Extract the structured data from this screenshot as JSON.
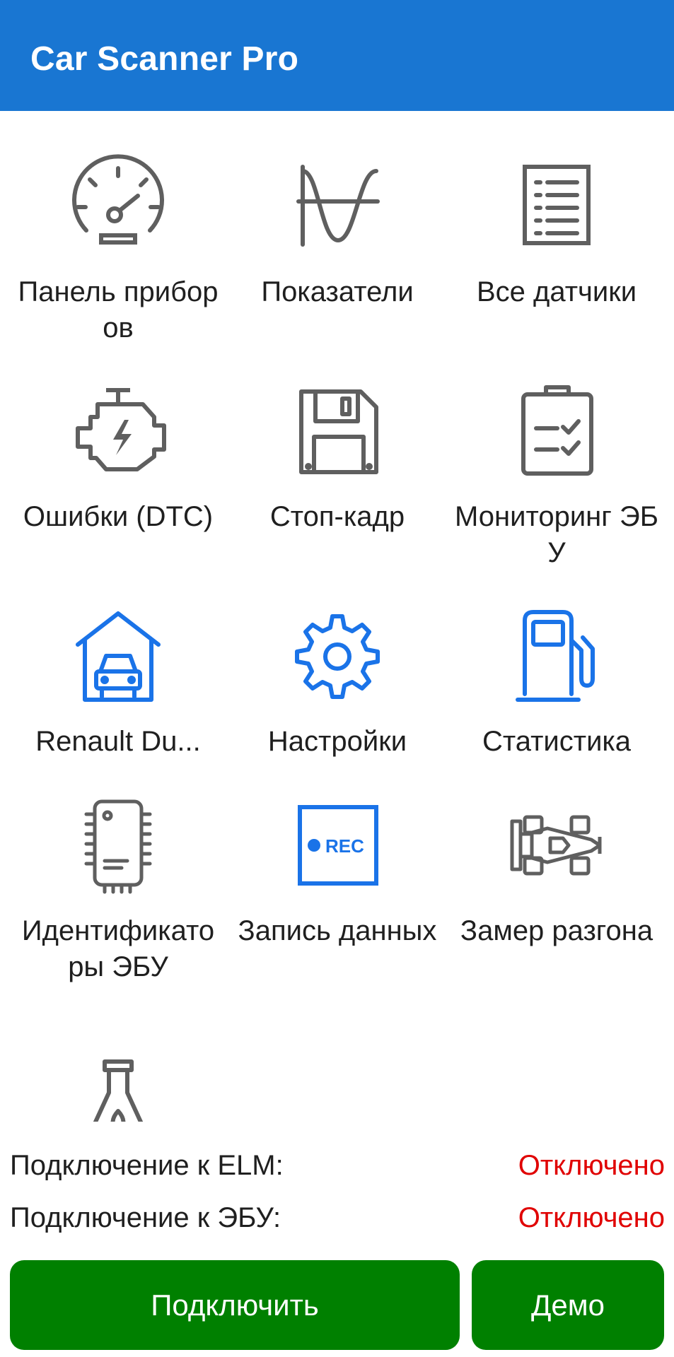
{
  "app_bar": {
    "title": "Car Scanner Pro"
  },
  "tiles": [
    {
      "label": "Панель приборов",
      "icon": "speedometer-icon"
    },
    {
      "label": "Показатели",
      "icon": "sine-wave-icon"
    },
    {
      "label": "Все датчики",
      "icon": "list-document-icon"
    },
    {
      "label": "Ошибки (DTC)",
      "icon": "check-engine-icon"
    },
    {
      "label": "Стоп-кадр",
      "icon": "floppy-disk-icon"
    },
    {
      "label": "Мониторинг ЭБУ",
      "icon": "clipboard-checklist-icon"
    },
    {
      "label": "Renault Du...",
      "icon": "garage-car-icon"
    },
    {
      "label": "Настройки",
      "icon": "gear-icon"
    },
    {
      "label": "Статистика",
      "icon": "fuel-pump-icon"
    },
    {
      "label": "Идентификаторы ЭБУ",
      "icon": "ecu-chip-icon"
    },
    {
      "label": "Запись данных",
      "icon": "rec-icon",
      "badge": "REC"
    },
    {
      "label": "Замер разгона",
      "icon": "race-car-icon"
    },
    {
      "label": "",
      "icon": "eco-flask-icon"
    }
  ],
  "status": {
    "elm_label": "Подключение к ELM:",
    "elm_value": "Отключено",
    "ecu_label": "Подключение к ЭБУ:",
    "ecu_value": "Отключено"
  },
  "buttons": {
    "connect": "Подключить",
    "demo": "Демо"
  },
  "colors": {
    "app_bar": "#1976d2",
    "icon_gray": "#5f5f5f",
    "icon_blue": "#1a73e8",
    "status_disconnected": "#e00000",
    "button_green": "#008000"
  }
}
